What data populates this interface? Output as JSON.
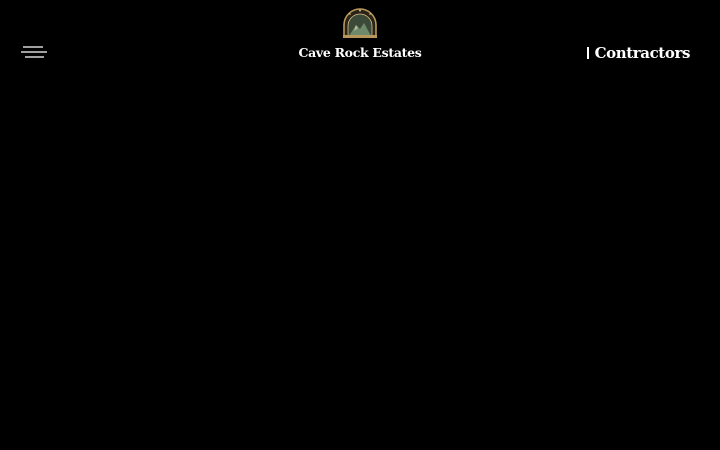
{
  "header": {
    "menu_icon": "hamburger-menu-icon",
    "logo_icon": "estate-emblem-icon",
    "site_title": "Cave Rock Estates",
    "nav_link_label": "Contractors"
  },
  "colors": {
    "background": "#000000",
    "text": "#ffffff",
    "logo_gold": "#b8985a",
    "logo_green": "#6f8a6a"
  }
}
